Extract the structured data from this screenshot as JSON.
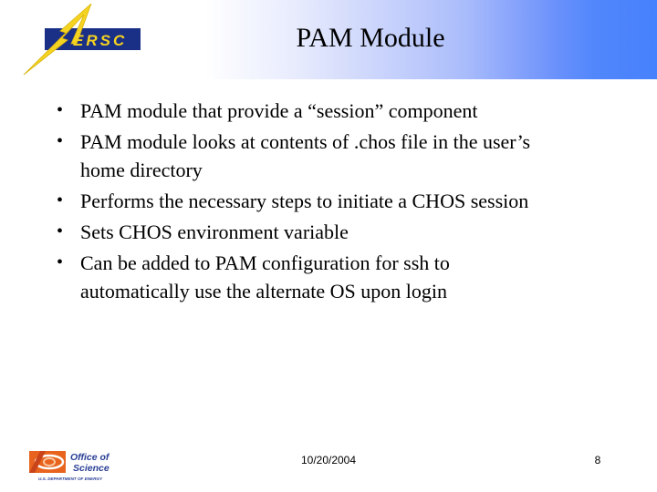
{
  "header": {
    "title": "PAM Module",
    "logo_text": "NERSC",
    "gradient_colors": [
      "#ffffff",
      "#4682fd"
    ]
  },
  "bullets": [
    {
      "lines": [
        "PAM module that provide a “session” component"
      ]
    },
    {
      "lines": [
        "PAM module looks at contents of .chos file in the user’s",
        "home directory"
      ]
    },
    {
      "lines": [
        "Performs the necessary steps to initiate a CHOS session"
      ]
    },
    {
      "lines": [
        "Sets CHOS environment variable"
      ]
    },
    {
      "lines": [
        "Can be added to PAM configuration for ssh to",
        "automatically use the alternate OS upon login"
      ]
    }
  ],
  "bullet_glyph": "•",
  "footer": {
    "logo_line1": "Office of",
    "logo_line2": "Science",
    "logo_subtitle": "U.S. DEPARTMENT OF ENERGY",
    "date": "10/20/2004",
    "page_number": "8"
  },
  "colors": {
    "nersc_blue": "#1a2f86",
    "nersc_yellow": "#f5d321",
    "doe_orange": "#e8641e",
    "doe_blue": "#2a3f96"
  }
}
